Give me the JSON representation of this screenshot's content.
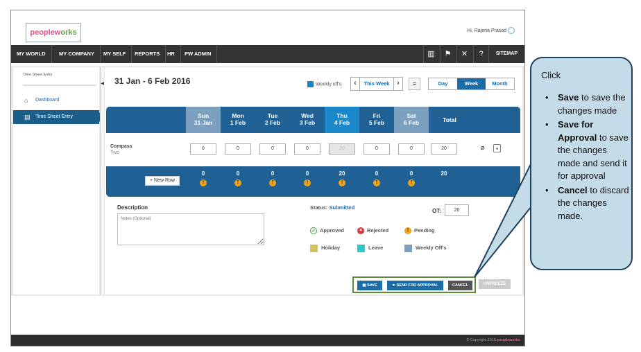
{
  "header": {
    "logo_main": "peoplew",
    "logo_accent": "orks",
    "greeting": "Hi, Rajena Prasad"
  },
  "nav": {
    "items": [
      "MY WORLD",
      "MY COMPANY",
      "MY SELF",
      "REPORTS",
      "HR",
      "PW ADMIN"
    ],
    "sitemap": "SITEMAP"
  },
  "sidebar": {
    "title": "Time Sheet Entry",
    "dashboard": "Dashboard",
    "timesheet": "Time Sheet Entry"
  },
  "main": {
    "date_range": "31 Jan - 6 Feb 2016",
    "weekly_off_label": "Weekly off's",
    "week_nav_label": "This Week",
    "view_day": "Day",
    "view_week": "Week",
    "view_month": "Month"
  },
  "grid": {
    "days": [
      {
        "dow": "Sun",
        "date": "31 Jan"
      },
      {
        "dow": "Mon",
        "date": "1 Feb"
      },
      {
        "dow": "Tue",
        "date": "2 Feb"
      },
      {
        "dow": "Wed",
        "date": "3 Feb"
      },
      {
        "dow": "Thu",
        "date": "4 Feb"
      },
      {
        "dow": "Fri",
        "date": "5 Feb"
      },
      {
        "dow": "Sat",
        "date": "6 Feb"
      }
    ],
    "total_label": "Total",
    "project": "Compass",
    "task": "Two",
    "hours": [
      "0",
      "0",
      "0",
      "0",
      "20",
      "0",
      "0"
    ],
    "row_total": "20",
    "new_row": "New Row",
    "footer_totals": [
      "0",
      "0",
      "0",
      "0",
      "20",
      "0",
      "0"
    ],
    "grand_total": "20"
  },
  "details": {
    "description_label": "Description",
    "description_placeholder": "Notes (Optional)",
    "status_label": "Status:",
    "status_value": "Submitted",
    "ot_label": "OT:",
    "ot_value": "20"
  },
  "legend": {
    "approved": "Approved",
    "rejected": "Rejected",
    "pending": "Pending",
    "holiday": "Holiday",
    "leave": "Leave",
    "weekly_offs": "Weekly Off's"
  },
  "actions": {
    "save": "SAVE",
    "send_for_approval": "SEND FOR APPROVAL",
    "cancel": "CANCEL",
    "unfreeze": "UNFREEZE"
  },
  "footer": {
    "copyright": "© Copyright 2016",
    "brand": "peopleworks"
  },
  "callout": {
    "title": "Click",
    "items": [
      {
        "bold": "Save",
        "text": " to save the changes made"
      },
      {
        "bold": "Save for Approval",
        "text": " to save the changes made and send it for approval"
      },
      {
        "bold": "Cancel",
        "text": " to discard the changes made."
      }
    ]
  },
  "colors": {
    "nav_bg": "#333333",
    "grid_blue": "#1f6195",
    "today_blue": "#1c87c9",
    "weekly_off": "#7d9fbf",
    "holiday": "#d4c460",
    "leave": "#2ac7cf",
    "callout_bg": "#c4dbe8"
  }
}
